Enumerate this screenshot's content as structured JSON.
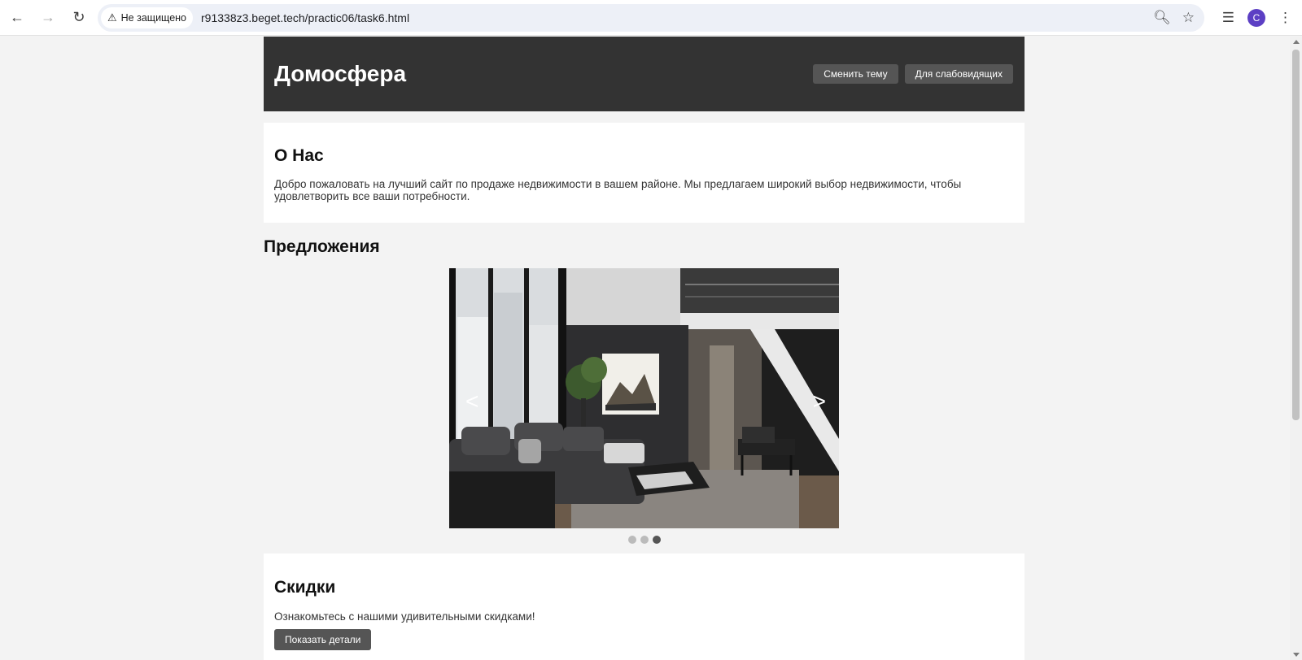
{
  "browser": {
    "security_label": "Не защищено",
    "url": "r91338z3.beget.tech/practic06/task6.html",
    "profile_initial": "C"
  },
  "header": {
    "logo": "Домосфера",
    "theme_button": "Сменить тему",
    "accessibility_button": "Для слабовидящих"
  },
  "about": {
    "title": "О Нас",
    "text": "Добро пожаловать на лучший сайт по продаже недвижимости в вашем районе. Мы предлагаем широкий выбор недвижимости, чтобы удовлетворить все ваши потребности."
  },
  "offers": {
    "title": "Предложения",
    "prev_arrow": "<",
    "next_arrow": ">",
    "slide_count": 3,
    "active_slide": 3
  },
  "discounts": {
    "title": "Скидки",
    "text": "Ознакомьтесь с нашими удивительными скидками!",
    "button": "Показать детали"
  },
  "colors": {
    "header_bg": "#333333",
    "button_bg": "#555555",
    "page_bg": "#f3f3f3"
  }
}
